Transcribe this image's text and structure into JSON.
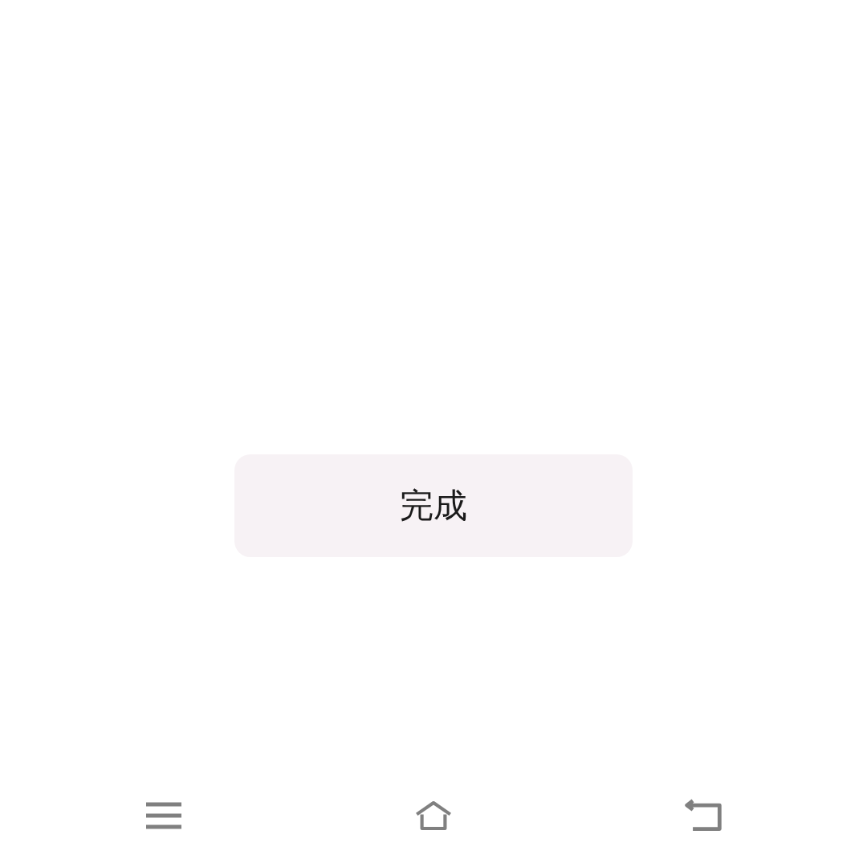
{
  "done_button": {
    "label": "完成"
  }
}
